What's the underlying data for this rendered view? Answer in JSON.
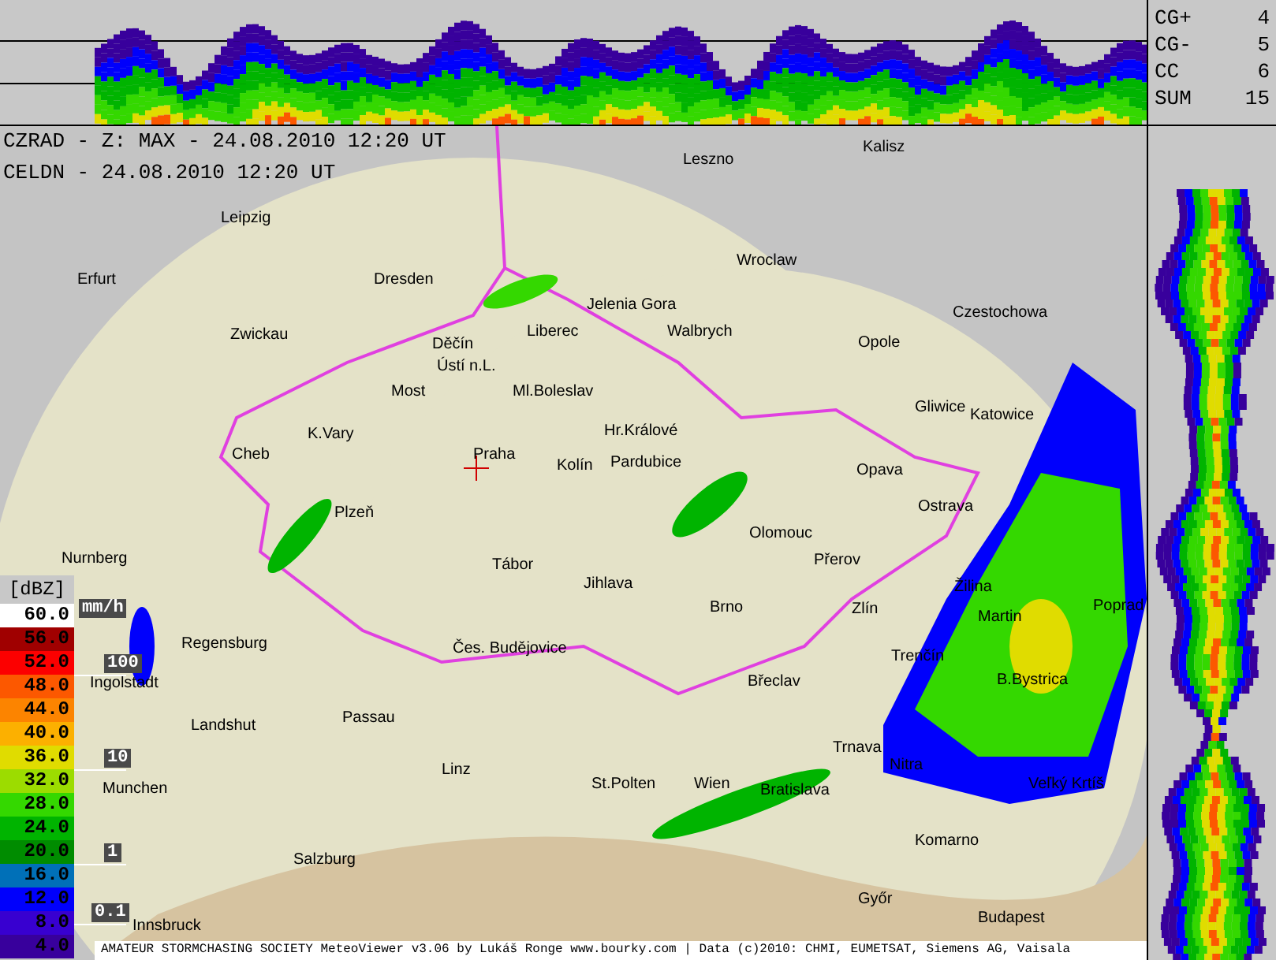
{
  "lightning_stats": [
    {
      "label": "CG+",
      "value": "4"
    },
    {
      "label": "CG-",
      "value": "5"
    },
    {
      "label": "CC",
      "value": "6"
    },
    {
      "label": "SUM",
      "value": "15"
    }
  ],
  "header": {
    "radar_line": "CZRAD - Z: MAX - 24.08.2010 12:20 UT",
    "lightning_line": "CELDN - 24.08.2010 12:20 UT"
  },
  "map": {
    "cities": [
      {
        "name": "Kalisz"
      },
      {
        "name": "Leszno"
      },
      {
        "name": "Leipzig"
      },
      {
        "name": "Wroclaw"
      },
      {
        "name": "Erfurt"
      },
      {
        "name": "Dresden"
      },
      {
        "name": "Jelenia Gora"
      },
      {
        "name": "Czestochowa"
      },
      {
        "name": "Zwickau"
      },
      {
        "name": "Děčín"
      },
      {
        "name": "Liberec"
      },
      {
        "name": "Walbrych"
      },
      {
        "name": "Opole"
      },
      {
        "name": "Ústí n.L."
      },
      {
        "name": "Most"
      },
      {
        "name": "Ml.Boleslav"
      },
      {
        "name": "Gliwice"
      },
      {
        "name": "Katowice"
      },
      {
        "name": "K.Vary"
      },
      {
        "name": "Hr.Králové"
      },
      {
        "name": "Cheb"
      },
      {
        "name": "Praha"
      },
      {
        "name": "Kolín"
      },
      {
        "name": "Pardubice"
      },
      {
        "name": "Opava"
      },
      {
        "name": "Plzeň"
      },
      {
        "name": "Ostrava"
      },
      {
        "name": "Olomouc"
      },
      {
        "name": "Nurnberg"
      },
      {
        "name": "Tábor"
      },
      {
        "name": "Přerov"
      },
      {
        "name": "Jihlava"
      },
      {
        "name": "Žilina"
      },
      {
        "name": "Brno"
      },
      {
        "name": "Zlín"
      },
      {
        "name": "Martin"
      },
      {
        "name": "Poprad"
      },
      {
        "name": "Regensburg"
      },
      {
        "name": "Čes. Budějovice"
      },
      {
        "name": "Trenčín"
      },
      {
        "name": "Ingolstadt"
      },
      {
        "name": "Břeclav"
      },
      {
        "name": "B.Bystrica"
      },
      {
        "name": "Landshut"
      },
      {
        "name": "Passau"
      },
      {
        "name": "Trnava"
      },
      {
        "name": "Linz"
      },
      {
        "name": "Nitra"
      },
      {
        "name": "Munchen"
      },
      {
        "name": "St.Polten"
      },
      {
        "name": "Wien"
      },
      {
        "name": "Bratislava"
      },
      {
        "name": "Veľký Krtíš"
      },
      {
        "name": "Komarno"
      },
      {
        "name": "Salzburg"
      },
      {
        "name": "Győr"
      },
      {
        "name": "Innsbruck"
      },
      {
        "name": "Budapest"
      }
    ]
  },
  "legend": {
    "unit": "[dBZ]",
    "levels": [
      {
        "value": "60.0",
        "color": "#ffffff"
      },
      {
        "value": "56.0",
        "color": "#a00000"
      },
      {
        "value": "52.0",
        "color": "#fc0000"
      },
      {
        "value": "48.0",
        "color": "#fc5800"
      },
      {
        "value": "44.0",
        "color": "#fc8400"
      },
      {
        "value": "40.0",
        "color": "#fcb000"
      },
      {
        "value": "36.0",
        "color": "#e0dc00"
      },
      {
        "value": "32.0",
        "color": "#9cdc00"
      },
      {
        "value": "28.0",
        "color": "#34d800"
      },
      {
        "value": "24.0",
        "color": "#00b400"
      },
      {
        "value": "20.0",
        "color": "#008c00"
      },
      {
        "value": "16.0",
        "color": "#0070b8"
      },
      {
        "value": "12.0",
        "color": "#0000fc"
      },
      {
        "value": "8.0",
        "color": "#3800d0"
      },
      {
        "value": "4.0",
        "color": "#38009c"
      }
    ],
    "rain_unit": "mm/h",
    "rain_marks": [
      {
        "label": "100"
      },
      {
        "label": "10"
      },
      {
        "label": "1"
      },
      {
        "label": "0.1"
      }
    ]
  },
  "footer": "AMATEUR STORMCHASING SOCIETY MeteoViewer v3.06 by Lukáš Ronge www.bourky.com | Data (c)2010: CHMI, EUMETSAT, Siemens AG, Vaisala"
}
